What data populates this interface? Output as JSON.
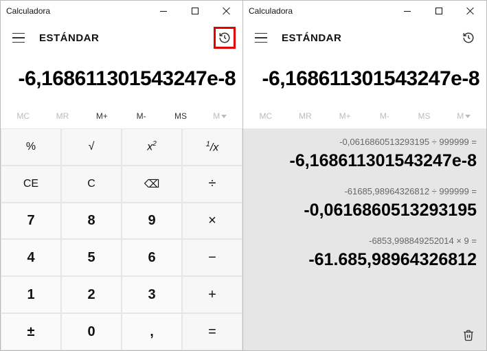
{
  "left": {
    "title": "Calculadora",
    "mode": "ESTÁNDAR",
    "display": "-6,168611301543247e-8",
    "memory": {
      "mc": "MC",
      "mr": "MR",
      "mplus": "M+",
      "mminus": "M-",
      "ms": "MS",
      "mdrop": "M"
    },
    "keys": {
      "percent": "%",
      "sqrt": "√",
      "square": "x²",
      "recip": "¹/x",
      "ce": "CE",
      "c": "C",
      "bksp": "⌫",
      "div": "÷",
      "k7": "7",
      "k8": "8",
      "k9": "9",
      "mul": "×",
      "k4": "4",
      "k5": "5",
      "k6": "6",
      "sub": "−",
      "k1": "1",
      "k2": "2",
      "k3": "3",
      "add": "+",
      "neg": "±",
      "k0": "0",
      "dec": ",",
      "eq": "="
    }
  },
  "right": {
    "title": "Calculadora",
    "mode": "ESTÁNDAR",
    "display": "-6,168611301543247e-8",
    "memory": {
      "mc": "MC",
      "mr": "MR",
      "mplus": "M+",
      "mminus": "M-",
      "ms": "MS",
      "mdrop": "M"
    },
    "history": [
      {
        "expr": "-0,0616860513293195   ÷   999999 =",
        "result": "-6,168611301543247e-8"
      },
      {
        "expr": "-61685,98964326812   ÷   999999 =",
        "result": "-0,0616860513293195"
      },
      {
        "expr": "-6853,998849252014   ×   9 =",
        "result": "-61.685,98964326812"
      }
    ]
  }
}
